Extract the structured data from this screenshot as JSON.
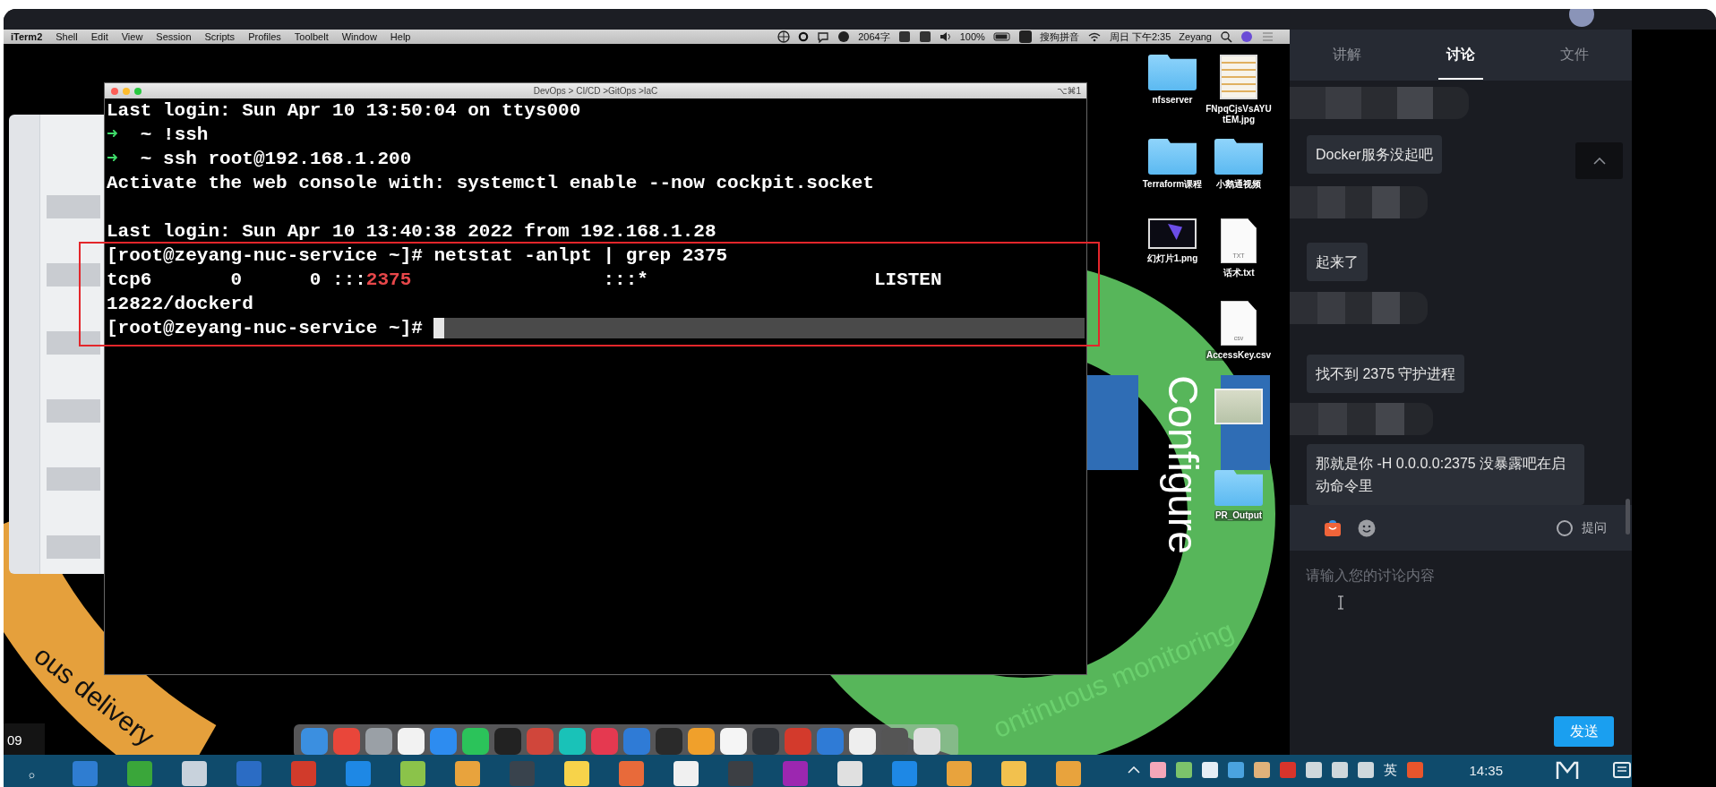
{
  "menubar": {
    "app": "iTerm2",
    "menus": [
      "Shell",
      "Edit",
      "View",
      "Session",
      "Scripts",
      "Profiles",
      "Toolbelt",
      "Window",
      "Help"
    ],
    "status_texts": [
      "2064字",
      "100%",
      "搜狗拼音",
      "周日 下午2:35",
      "Zeyang"
    ]
  },
  "terminal": {
    "title": "DevOps > CI/CD >GitOps >IaC",
    "shortcut": "⌥⌘1",
    "lines": [
      {
        "kind": "text",
        "current": false,
        "segments": [
          {
            "kind": "text",
            "text": "Last login: Sun Apr 10 13:50:04 on ttys000"
          }
        ]
      },
      {
        "kind": "text",
        "current": false,
        "segments": [
          {
            "kind": "arrow",
            "text": "➜"
          },
          {
            "kind": "text",
            "text": "  ~ !ssh"
          }
        ]
      },
      {
        "kind": "text",
        "current": false,
        "segments": [
          {
            "kind": "arrow",
            "text": "➜"
          },
          {
            "kind": "text",
            "text": "  ~ ssh root@192.168.1.200"
          }
        ]
      },
      {
        "kind": "text",
        "current": false,
        "segments": [
          {
            "kind": "text",
            "text": "Activate the web console with: systemctl enable --now cockpit.socket"
          }
        ]
      },
      {
        "kind": "blank",
        "current": false
      },
      {
        "kind": "text",
        "current": false,
        "segments": [
          {
            "kind": "text",
            "text": "Last login: Sun Apr 10 13:40:38 2022 from 192.168.1.28"
          }
        ]
      },
      {
        "kind": "text",
        "current": false,
        "segments": [
          {
            "kind": "text",
            "text": "[root@zeyang-nuc-service ~]# netstat -anlpt | grep 2375"
          }
        ]
      },
      {
        "kind": "text",
        "current": false,
        "segments": [
          {
            "kind": "text",
            "text": "tcp6       0      0 :::"
          },
          {
            "kind": "match",
            "text": "2375"
          },
          {
            "kind": "text",
            "text": "                 :::*                    LISTEN"
          }
        ]
      },
      {
        "kind": "text",
        "current": false,
        "segments": [
          {
            "kind": "text",
            "text": "12822/dockerd"
          }
        ]
      },
      {
        "kind": "text",
        "current": true,
        "cursor": true,
        "segments": [
          {
            "kind": "text",
            "text": "[root@zeyang-nuc-service ~]# "
          }
        ]
      }
    ]
  },
  "desktop_icons": [
    {
      "kind": "folder",
      "label": "nfsserver"
    },
    {
      "kind": "image",
      "label": "FNpqCjsVsAYUtEM.jpg"
    },
    {
      "kind": "folder",
      "label": "Terraform课程"
    },
    {
      "kind": "folder",
      "label": "小鹅通视频"
    },
    {
      "kind": "slide",
      "label": "幻灯片1.png"
    },
    {
      "kind": "document",
      "badge": "TXT",
      "label": "话术.txt"
    },
    {
      "kind": "document",
      "badge": "csv",
      "label": "AccessKey.csv"
    },
    {
      "kind": "picture"
    },
    {
      "kind": "folder",
      "label": "PR_Output"
    }
  ],
  "wallpaper": {
    "texts": [
      "Configure",
      "ontinuous monitoring",
      "ous delivery"
    ]
  },
  "video_timestamp": "09",
  "chat": {
    "tabs": [
      {
        "label": "讲解",
        "selected": false
      },
      {
        "label": "讨论",
        "selected": true
      },
      {
        "label": "文件",
        "selected": false
      }
    ],
    "messages": [
      {
        "kind": "redacted"
      },
      {
        "kind": "message",
        "text": "Docker服务没起吧"
      },
      {
        "kind": "redacted"
      },
      {
        "kind": "message",
        "text": "起来了"
      },
      {
        "kind": "redacted"
      },
      {
        "kind": "message",
        "text": "找不到 2375 守护进程"
      },
      {
        "kind": "redacted"
      },
      {
        "kind": "message",
        "text": "那就是你 -H 0.0.0.0:2375 没暴露吧在启动命令里"
      }
    ],
    "ask_option": {
      "label": "提问",
      "checked": false
    },
    "input": {
      "placeholder": "请输入您的讨论内容"
    },
    "send_button": "发送"
  },
  "taskbar": {
    "ime": "英",
    "time": "14:35"
  }
}
